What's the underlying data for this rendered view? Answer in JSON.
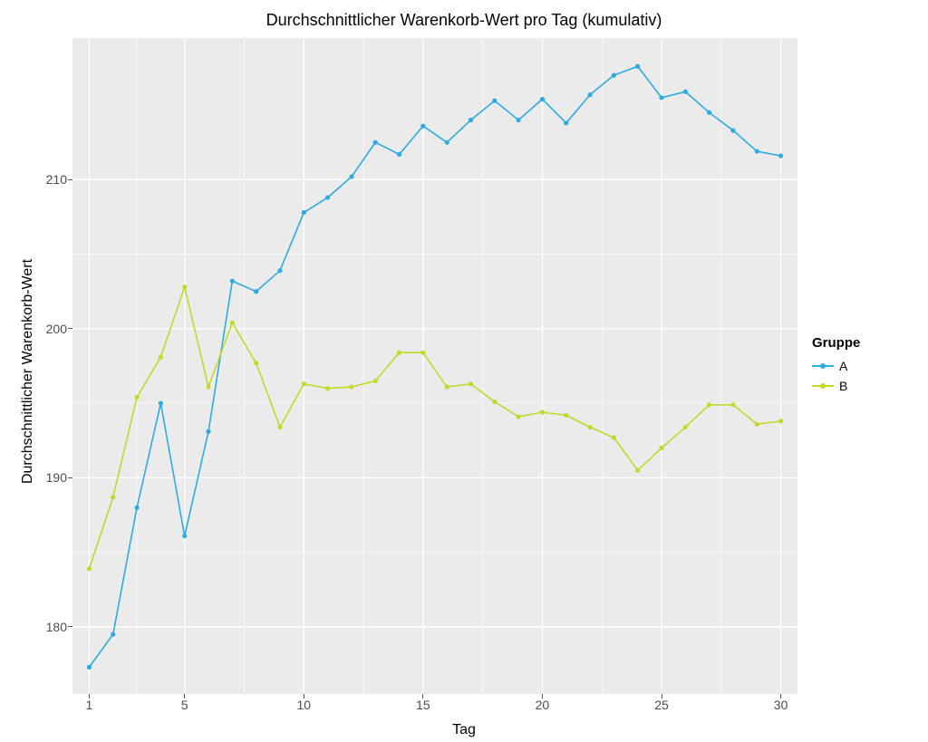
{
  "chart_data": {
    "type": "line",
    "title": "Durchschnittlicher Warenkorb-Wert pro Tag (kumulativ)",
    "xlabel": "Tag",
    "ylabel": "Durchschnittlicher Warenkorb-Wert",
    "legend_title": "Gruppe",
    "x": [
      1,
      2,
      3,
      4,
      5,
      6,
      7,
      8,
      9,
      10,
      11,
      12,
      13,
      14,
      15,
      16,
      17,
      18,
      19,
      20,
      21,
      22,
      23,
      24,
      25,
      26,
      27,
      28,
      29,
      30
    ],
    "series": [
      {
        "name": "A",
        "color": "#2dabe2",
        "values": [
          177.3,
          179.5,
          188.0,
          195.0,
          186.1,
          193.1,
          203.2,
          202.5,
          203.9,
          207.8,
          208.8,
          210.2,
          212.5,
          211.7,
          213.6,
          212.5,
          214.0,
          215.3,
          214.0,
          215.4,
          213.8,
          215.7,
          217.0,
          217.6,
          215.5,
          215.9,
          214.5,
          213.3,
          211.9,
          211.6
        ]
      },
      {
        "name": "B",
        "color": "#c3d82b",
        "values": [
          183.9,
          188.7,
          195.4,
          198.1,
          202.8,
          196.1,
          200.4,
          197.7,
          193.4,
          196.3,
          196.0,
          196.1,
          196.5,
          198.4,
          198.4,
          196.1,
          196.3,
          195.1,
          194.1,
          194.4,
          194.2,
          193.4,
          192.7,
          190.5,
          192.0,
          193.4,
          194.9,
          194.9,
          193.6,
          193.8
        ]
      }
    ],
    "x_ticks": [
      1,
      5,
      10,
      15,
      20,
      25,
      30
    ],
    "y_ticks": [
      180,
      190,
      200,
      210
    ],
    "x_range": [
      0.3,
      30.7
    ],
    "y_range": [
      175.5,
      219.5
    ]
  }
}
